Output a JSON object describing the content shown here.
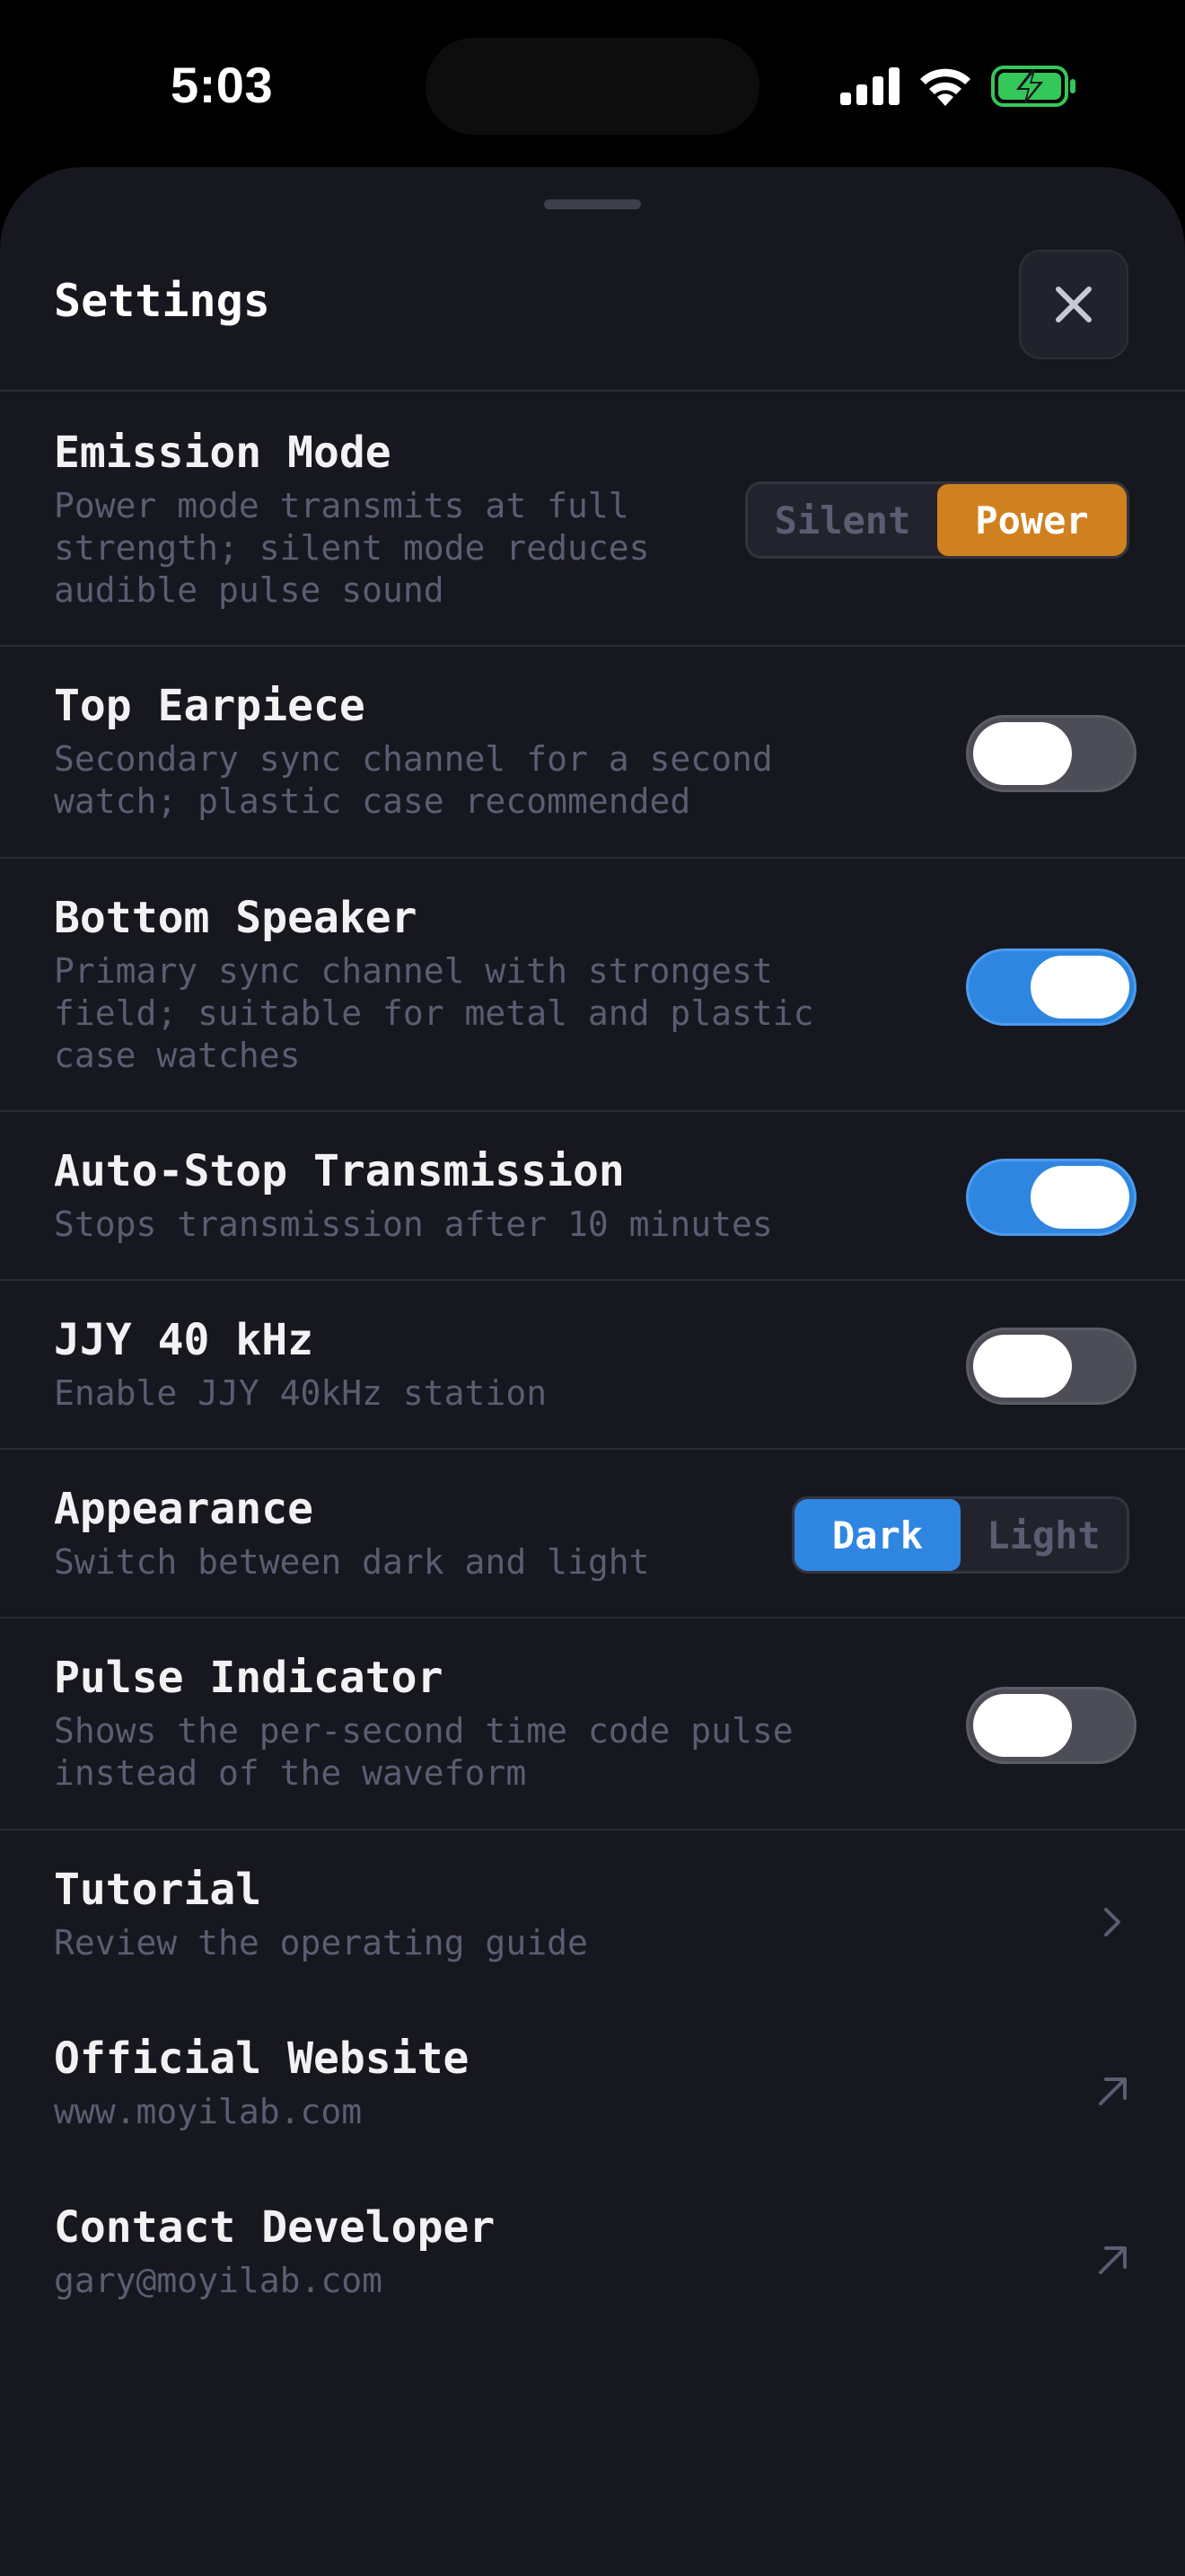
{
  "status_bar": {
    "time": "5:03"
  },
  "sheet": {
    "title": "Settings",
    "close_icon": "close-icon"
  },
  "settings": {
    "emission_mode": {
      "title": "Emission Mode",
      "description": "Power mode transmits at full\nstrength; silent mode reduces\naudible pulse sound",
      "options": [
        "Silent",
        "Power"
      ],
      "selected": "Power",
      "accent": "#d0811f"
    },
    "top_earpiece": {
      "title": "Top Earpiece",
      "description": "Secondary sync channel for a second\nwatch; plastic case recommended",
      "enabled": false
    },
    "bottom_speaker": {
      "title": "Bottom Speaker",
      "description": "Primary sync channel with strongest\nfield; suitable for metal and plastic\ncase watches",
      "enabled": true
    },
    "auto_stop": {
      "title": "Auto-Stop Transmission",
      "description": "Stops transmission after 10 minutes",
      "enabled": true
    },
    "jjy": {
      "title": "JJY 40 kHz",
      "description": "Enable JJY 40kHz station",
      "enabled": false
    },
    "appearance": {
      "title": "Appearance",
      "description": "Switch between dark and light",
      "options": [
        "Dark",
        "Light"
      ],
      "selected": "Dark",
      "accent": "#2f86e0"
    },
    "pulse_indicator": {
      "title": "Pulse Indicator",
      "description": "Shows the per-second time code pulse\ninstead of the waveform",
      "enabled": false
    }
  },
  "links": {
    "tutorial": {
      "title": "Tutorial",
      "description": "Review the operating guide",
      "icon": "chevron-right-icon"
    },
    "website": {
      "title": "Official Website",
      "description": "www.moyilab.com",
      "icon": "external-link-arrow-icon"
    },
    "contact": {
      "title": "Contact Developer",
      "description": "gary@moyilab.com",
      "icon": "external-link-arrow-icon"
    }
  },
  "colors": {
    "sheet_background": "#17171f",
    "toggle_on": "#2f86e0",
    "toggle_off": "#4d4d57",
    "battery_charging": "#34c759"
  }
}
